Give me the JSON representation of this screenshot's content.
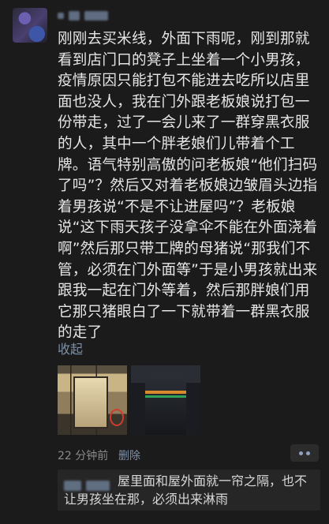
{
  "post": {
    "text": "刚刚去买米线，外面下雨呢，刚到那就看到店门口的凳子上坐着一个小男孩，疫情原因只能打包不能进去吃所以店里面也没人，我在门外跟老板娘说打包一份带走，过了一会儿来了一群穿黑衣服的人，其中一个胖老娘们儿带着个工牌。语气特别高傲的问老板娘“他们扫码了吗”？然后又对着老板娘边皱眉头边指着男孩说“不是不让进屋吗”？老板娘说“这下雨天孩子没拿伞不能在外面浇着啊”然后那只带工牌的母猪说“那我们不管，必须在门外面等”于是小男孩就出来跟我一起在门外等着，然后那胖娘们用它那只猪眼白了一下就带着一群黑衣服的走了",
    "collapse_label": "收起",
    "time": "22 分钟前",
    "delete_label": "删除",
    "photos": [
      "storefront-photo",
      "black-jacket-photo"
    ]
  },
  "comment": {
    "text": "屋里面和屋外面就一帘之隔，也不让男孩坐在那，必须出来淋雨"
  },
  "colors": {
    "background": "#1b1b1b",
    "link": "#7d90a9",
    "text": "#e6e6e6"
  }
}
